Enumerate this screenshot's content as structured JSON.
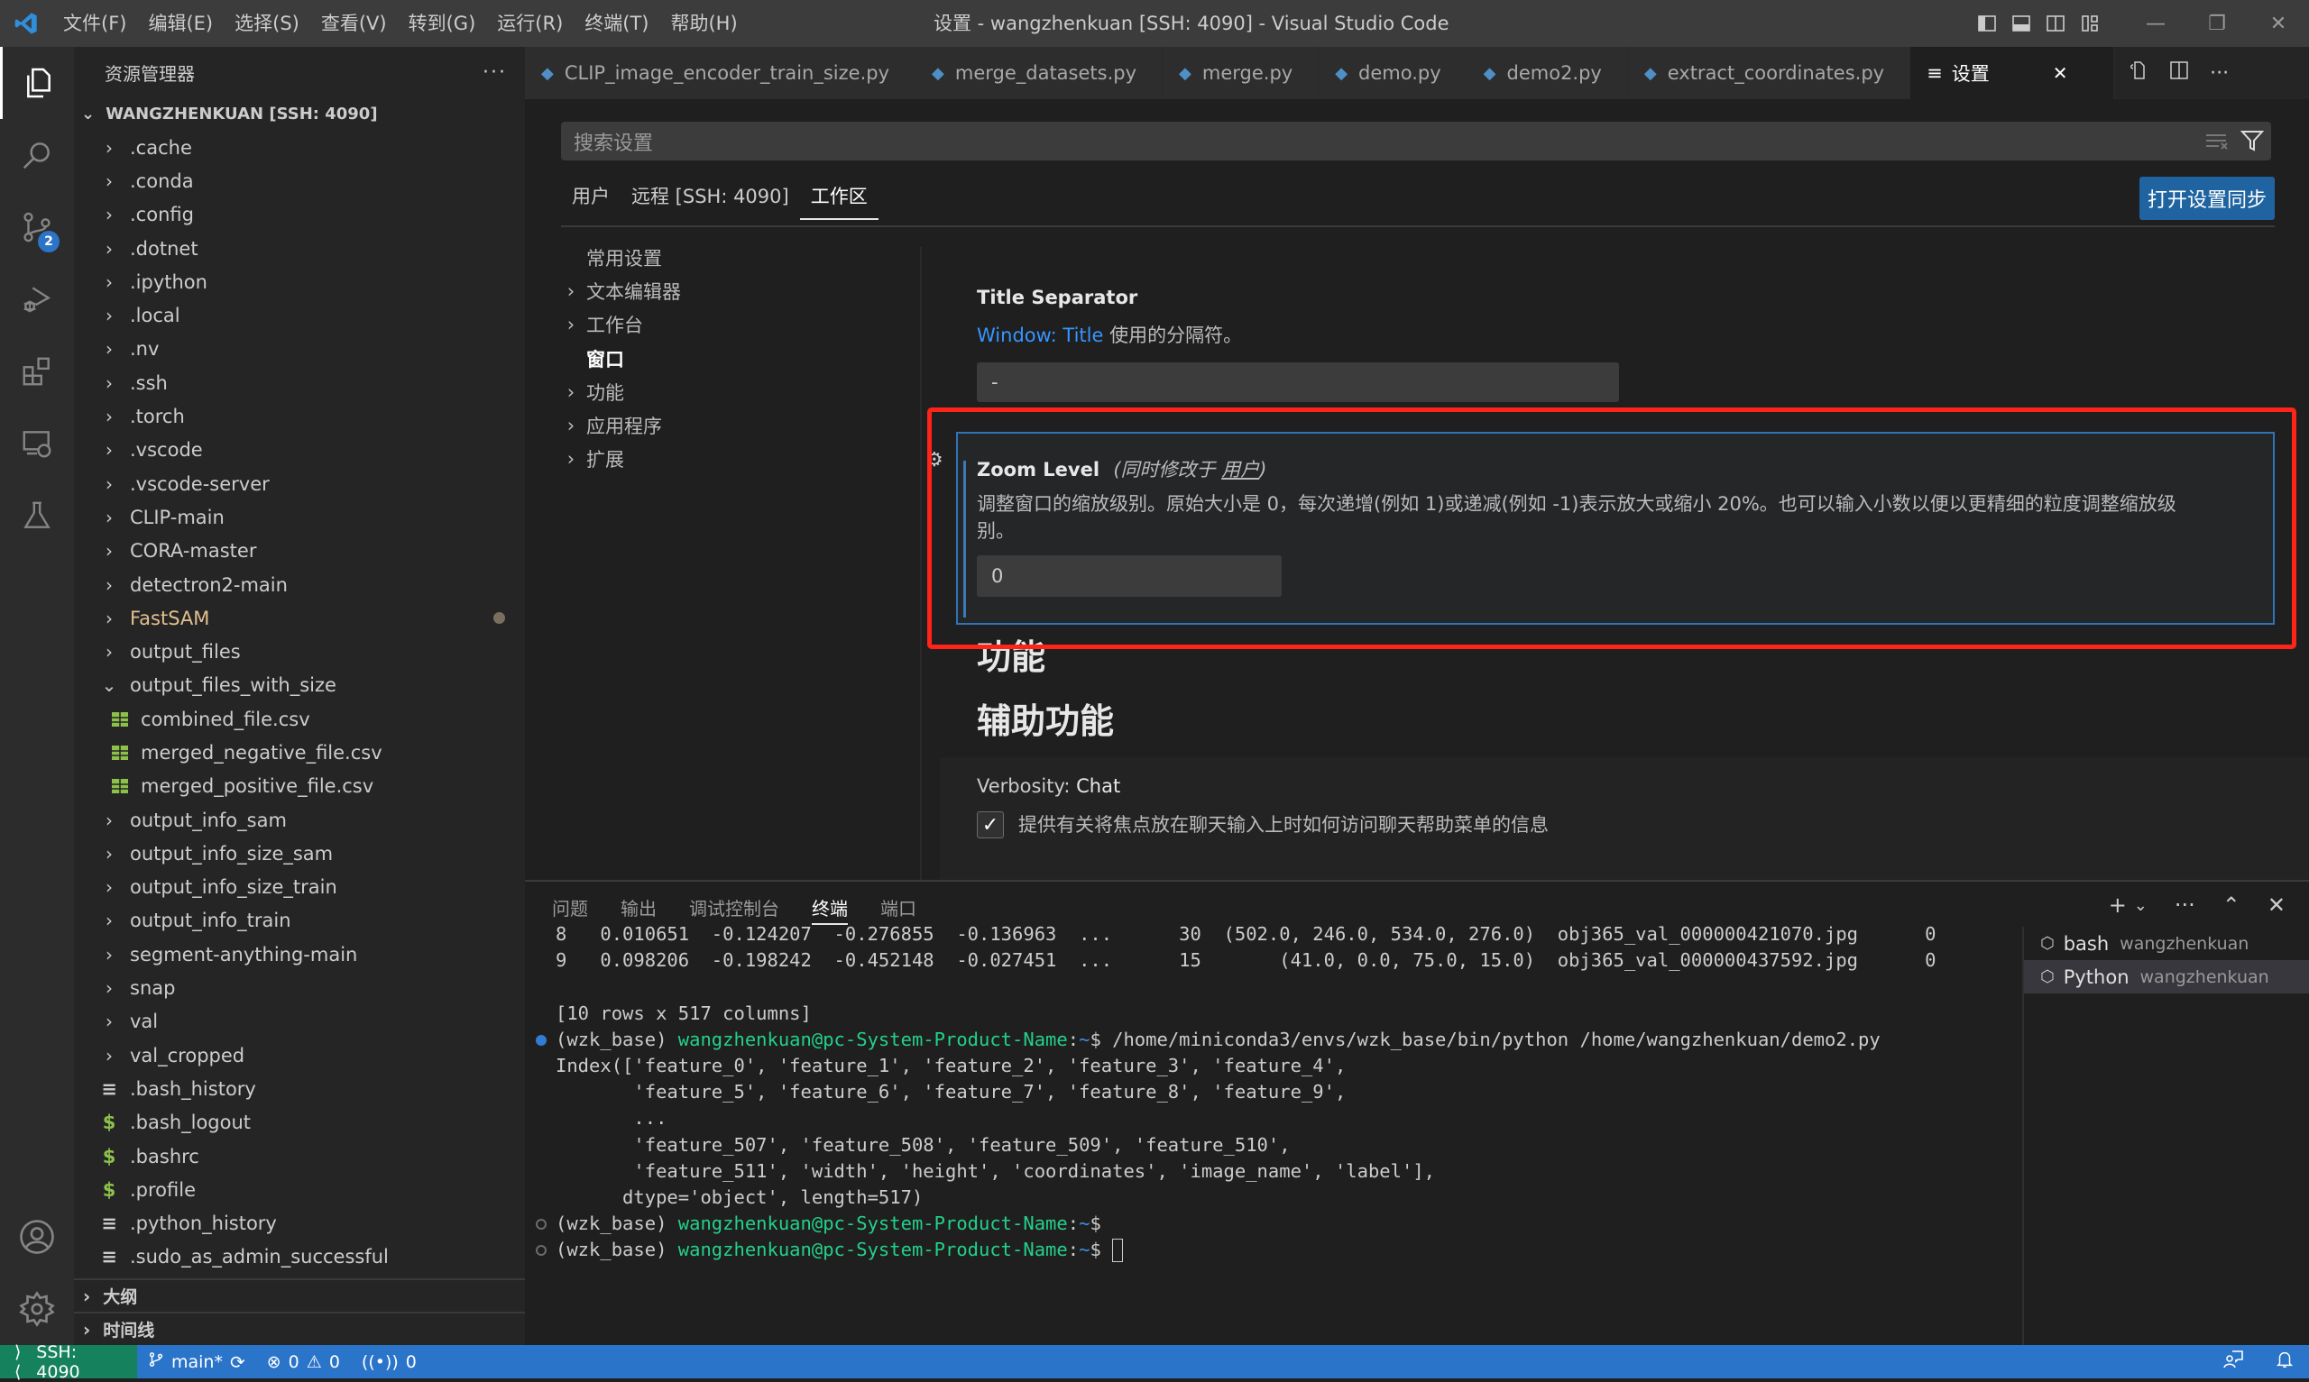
{
  "titlebar": {
    "menus": [
      "文件(F)",
      "编辑(E)",
      "选择(S)",
      "查看(V)",
      "转到(G)",
      "运行(R)",
      "终端(T)",
      "帮助(H)"
    ],
    "window_title": "设置 - wangzhenkuan [SSH: 4090] - Visual Studio Code",
    "layout_icons": [
      "toggle-primary-sidebar-icon",
      "toggle-panel-icon",
      "toggle-secondary-sidebar-icon",
      "customize-layout-icon"
    ],
    "window_controls": {
      "minimize": "—",
      "restore": "❐",
      "close": "✕"
    }
  },
  "activitybar": {
    "items": [
      "explorer-icon",
      "search-icon",
      "source-control-icon",
      "run-debug-icon",
      "extensions-icon",
      "remote-explorer-icon",
      "testing-icon"
    ],
    "source_control_badge": "2",
    "bottom": [
      "account-icon",
      "manage-gear-icon"
    ]
  },
  "sidebar": {
    "title": "资源管理器",
    "more": "···",
    "root": "WANGZHENKUAN [SSH: 4090]",
    "items": [
      {
        "label": ".cache",
        "type": "folder"
      },
      {
        "label": ".conda",
        "type": "folder"
      },
      {
        "label": ".config",
        "type": "folder"
      },
      {
        "label": ".dotnet",
        "type": "folder"
      },
      {
        "label": ".ipython",
        "type": "folder"
      },
      {
        "label": ".local",
        "type": "folder"
      },
      {
        "label": ".nv",
        "type": "folder"
      },
      {
        "label": ".ssh",
        "type": "folder"
      },
      {
        "label": ".torch",
        "type": "folder"
      },
      {
        "label": ".vscode",
        "type": "folder"
      },
      {
        "label": ".vscode-server",
        "type": "folder"
      },
      {
        "label": "CLIP-main",
        "type": "folder"
      },
      {
        "label": "CORA-master",
        "type": "folder"
      },
      {
        "label": "detectron2-main",
        "type": "folder"
      },
      {
        "label": "FastSAM",
        "type": "folder",
        "modified": true
      },
      {
        "label": "output_files",
        "type": "folder"
      },
      {
        "label": "output_files_with_size",
        "type": "folder",
        "expanded": true
      },
      {
        "label": "combined_file.csv",
        "type": "csv"
      },
      {
        "label": "merged_negative_file.csv",
        "type": "csv"
      },
      {
        "label": "merged_positive_file.csv",
        "type": "csv"
      },
      {
        "label": "output_info_sam",
        "type": "folder"
      },
      {
        "label": "output_info_size_sam",
        "type": "folder"
      },
      {
        "label": "output_info_size_train",
        "type": "folder"
      },
      {
        "label": "output_info_train",
        "type": "folder"
      },
      {
        "label": "segment-anything-main",
        "type": "folder"
      },
      {
        "label": "snap",
        "type": "folder"
      },
      {
        "label": "val",
        "type": "folder"
      },
      {
        "label": "val_cropped",
        "type": "folder"
      },
      {
        "label": ".bash_history",
        "type": "text"
      },
      {
        "label": ".bash_logout",
        "type": "shell"
      },
      {
        "label": ".bashrc",
        "type": "shell"
      },
      {
        "label": ".profile",
        "type": "shell"
      },
      {
        "label": ".python_history",
        "type": "text"
      },
      {
        "label": ".sudo_as_admin_successful",
        "type": "text"
      }
    ],
    "sections": [
      "大纲",
      "时间线"
    ]
  },
  "editor": {
    "tabs": [
      {
        "label": "CLIP_image_encoder_train_size.py"
      },
      {
        "label": "merge_datasets.py"
      },
      {
        "label": "merge.py"
      },
      {
        "label": "demo.py"
      },
      {
        "label": "demo2.py"
      },
      {
        "label": "extract_coordinates.py"
      },
      {
        "label": "设置",
        "active": true
      }
    ],
    "close": "✕"
  },
  "settings": {
    "search_placeholder": "搜索设置",
    "scopes": [
      "用户",
      "远程 [SSH: 4090]",
      "工作区"
    ],
    "active_scope": "工作区",
    "sync_button": "打开设置同步",
    "toc": [
      {
        "label": "常用设置",
        "chevron": false
      },
      {
        "label": "文本编辑器",
        "chevron": true
      },
      {
        "label": "工作台",
        "chevron": true
      },
      {
        "label": "窗口",
        "chevron": false,
        "active": true
      },
      {
        "label": "功能",
        "chevron": true
      },
      {
        "label": "应用程序",
        "chevron": true
      },
      {
        "label": "扩展",
        "chevron": true
      }
    ],
    "title_separator": {
      "title": "Title Separator",
      "desc_link": "Window: Title",
      "desc_rest": " 使用的分隔符。",
      "value": "-"
    },
    "zoom_level": {
      "title": "Zoom Level",
      "modified_prefix": "(同时修改于 ",
      "modified_link": "用户",
      "modified_suffix": ")",
      "desc_line1": "调整窗口的缩放级别。原始大小是 0，每次递增(例如 1)或递减(例如 -1)表示放大或缩小 20%。也可以输入小数以便以更精细的粒度调整缩放级",
      "desc_line2": "别。",
      "value": "0"
    },
    "heading_features": "功能",
    "heading_accessibility": "辅助功能",
    "verbosity": {
      "title_prefix": "Verbosity: ",
      "title_bold": "Chat",
      "checkbox_label": "提供有关将焦点放在聊天输入上时如何访问聊天帮助菜单的信息",
      "checked": true
    }
  },
  "panel": {
    "tabs": [
      "问题",
      "输出",
      "调试控制台",
      "终端",
      "端口"
    ],
    "active_tab": "终端",
    "actions": [
      "+",
      "⌄",
      "···",
      "⌃",
      "✕"
    ],
    "terminal_lines": [
      {
        "text": "8   0.010651  -0.124207  -0.276855  -0.136963  ...      30  (502.0, 246.0, 534.0, 276.0)  obj365_val_000000421070.jpg      0"
      },
      {
        "text": "9   0.098206  -0.198242  -0.452148  -0.027451  ...      15       (41.0, 0.0, 75.0, 15.0)  obj365_val_000000437592.jpg      0"
      },
      {
        "text": ""
      },
      {
        "text": "[10 rows x 517 columns]"
      },
      {
        "prompt": true,
        "env": "(wzk_base) ",
        "user": "wangzhenkuan@pc-System-Product-Name",
        "cwd": "~",
        "cmd": "$ /home/miniconda3/envs/wzk_base/bin/python /home/wangzhenkuan/demo2.py",
        "marker": "blue"
      },
      {
        "text": "Index(['feature_0', 'feature_1', 'feature_2', 'feature_3', 'feature_4',"
      },
      {
        "text": "       'feature_5', 'feature_6', 'feature_7', 'feature_8', 'feature_9',"
      },
      {
        "text": "       ..."
      },
      {
        "text": "       'feature_507', 'feature_508', 'feature_509', 'feature_510',"
      },
      {
        "text": "       'feature_511', 'width', 'height', 'coordinates', 'image_name', 'label'],"
      },
      {
        "text": "      dtype='object', length=517)"
      },
      {
        "prompt": true,
        "env": "(wzk_base) ",
        "user": "wangzhenkuan@pc-System-Product-Name",
        "cwd": "~",
        "cmd": "$",
        "marker": "hollow"
      },
      {
        "prompt": true,
        "env": "(wzk_base) ",
        "user": "wangzhenkuan@pc-System-Product-Name",
        "cwd": "~",
        "cmd": "$ ",
        "marker": "hollow",
        "cursor": true
      }
    ],
    "terminals": [
      {
        "name": "bash",
        "owner": "wangzhenkuan"
      },
      {
        "name": "Python",
        "owner": "wangzhenkuan",
        "active": true
      }
    ]
  },
  "statusbar": {
    "remote": "SSH: 4090",
    "branch": "main*",
    "errors": "0",
    "warnings": "0",
    "ports": "0",
    "colors": {
      "remote_bg": "#16825d",
      "bar_bg": "#2a74c9"
    }
  }
}
